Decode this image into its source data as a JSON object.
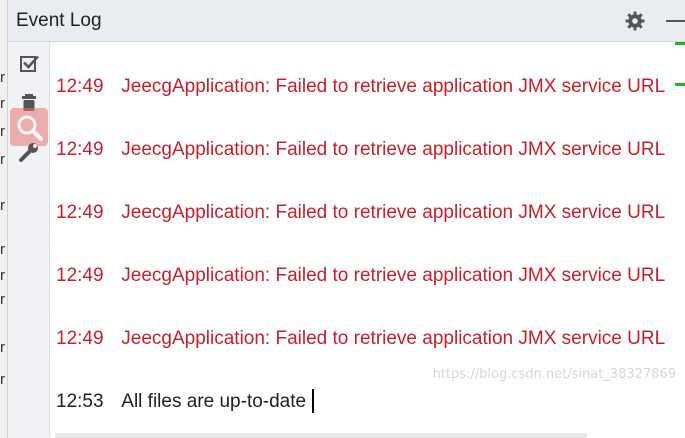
{
  "gutter": {
    "chars": [
      "r",
      "r",
      "r",
      "r",
      "r",
      "r",
      "r",
      "r",
      "r",
      "r"
    ]
  },
  "panel": {
    "title": "Event Log"
  },
  "toolbar": {
    "icons": [
      "checkbox-icon",
      "trash-icon",
      "search-icon",
      "wrench-icon"
    ]
  },
  "log": {
    "entries": [
      {
        "time": "12:49",
        "message": "JeecgApplication: Failed to retrieve application JMX service URL",
        "level": "error"
      },
      {
        "time": "12:49",
        "message": "JeecgApplication: Failed to retrieve application JMX service URL",
        "level": "error"
      },
      {
        "time": "12:49",
        "message": "JeecgApplication: Failed to retrieve application JMX service URL",
        "level": "error"
      },
      {
        "time": "12:49",
        "message": "JeecgApplication: Failed to retrieve application JMX service URL",
        "level": "error"
      },
      {
        "time": "12:49",
        "message": "JeecgApplication: Failed to retrieve application JMX service URL",
        "level": "error"
      },
      {
        "time": "12:53",
        "message": "All files are up-to-date",
        "level": "info"
      }
    ]
  },
  "watermark": "https://blog.csdn.net/sinat_38327869",
  "colors": {
    "error": "#c7202a",
    "info": "#1f1f1f",
    "search_highlight": "#ea7171",
    "status_marker": "#24b324"
  }
}
